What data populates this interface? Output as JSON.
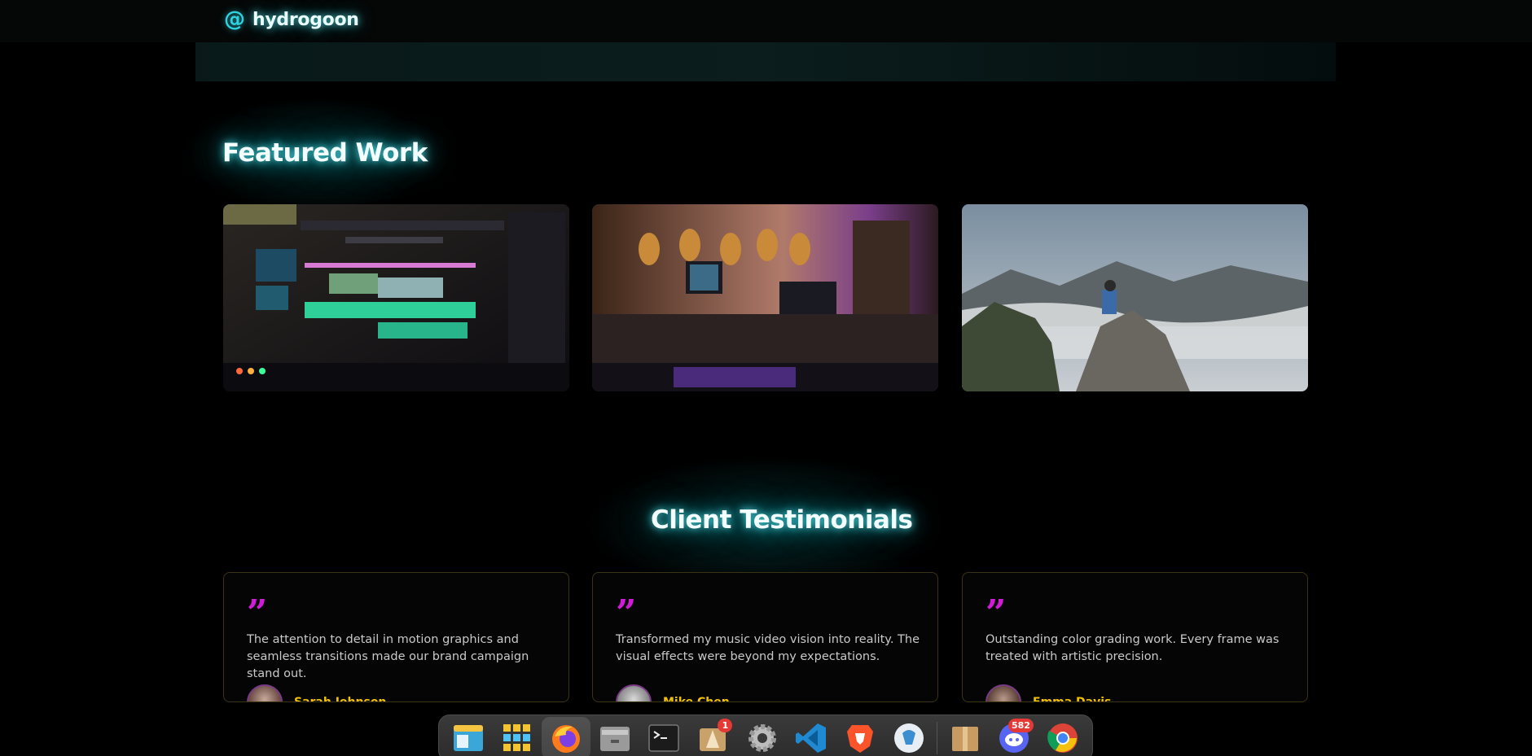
{
  "header": {
    "brand_symbol": "@",
    "brand": "hydrogoon"
  },
  "featured": {
    "title": "Featured Work",
    "items": [
      {
        "icon": "video-editing-timeline-image"
      },
      {
        "icon": "music-studio-guitars-image"
      },
      {
        "icon": "photographer-mountain-fog-image"
      }
    ]
  },
  "testimonials": {
    "title": "Client Testimonials",
    "items": [
      {
        "quote": "The attention to detail in motion graphics and seamless transitions made our brand campaign stand out.",
        "name": "Sarah Johnson"
      },
      {
        "quote": "Transformed my music video vision into reality. The visual effects were beyond my expectations.",
        "name": "Mike Chen"
      },
      {
        "quote": "Outstanding color grading work. Every frame was treated with artistic precision.",
        "name": "Emma Davis"
      }
    ]
  },
  "dock": {
    "items": [
      {
        "icon": "file-manager-icon"
      },
      {
        "icon": "app-grid-icon"
      },
      {
        "icon": "firefox-icon",
        "active": true
      },
      {
        "icon": "archive-manager-icon"
      },
      {
        "icon": "terminal-icon"
      },
      {
        "icon": "software-updater-icon",
        "badge": "1"
      },
      {
        "icon": "settings-gear-icon"
      },
      {
        "icon": "vscode-icon"
      },
      {
        "icon": "brave-browser-icon"
      },
      {
        "icon": "kde-connect-icon"
      },
      {
        "icon": "package-box-icon"
      },
      {
        "icon": "discord-icon",
        "badge": "582"
      },
      {
        "icon": "chrome-icon"
      }
    ]
  },
  "colors": {
    "accent_cyan": "#2fd3e0",
    "quote_magenta": "#d21bd8",
    "name_gold": "#f2c100"
  }
}
